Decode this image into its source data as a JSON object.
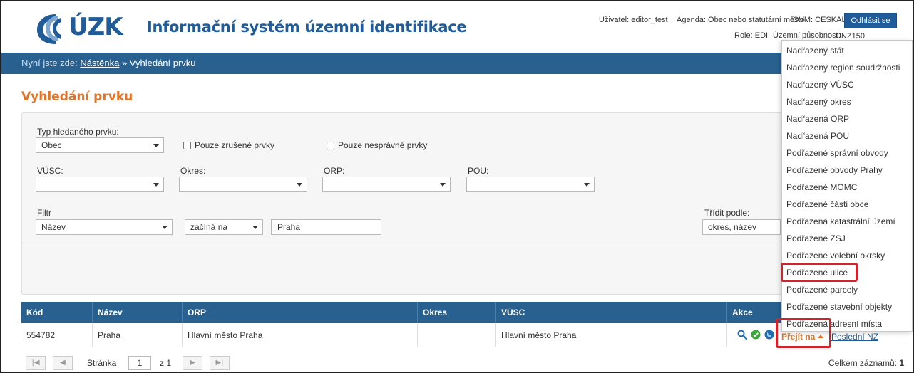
{
  "header": {
    "logo_text": "ÚZK",
    "app_title": "Informační systém územní identifikace",
    "user_label": "Uživatel: editor_test",
    "agenda_label": "Agenda: Obec nebo statutární město",
    "ovm_label": "OVM: CESKALIPA",
    "role_label": "Role: EDI",
    "scope_label": "Územní působnost:",
    "scope_value": "UNZ150",
    "logout_label": "Odhlásit se"
  },
  "breadcrumb": {
    "lead": "Nyní jste zde:",
    "home": "Nástěnka",
    "separator": "»",
    "current": "Vyhledání prvku"
  },
  "page_title": "Vyhledání prvku",
  "filters": {
    "type_label": "Typ hledaného prvku:",
    "type_value": "Obec",
    "only_cancelled_label": "Pouze zrušené prvky",
    "only_incorrect_label": "Pouze nesprávné prvky",
    "vusc_label": "VÚSC:",
    "okres_label": "Okres:",
    "orp_label": "ORP:",
    "pou_label": "POU:",
    "filter_label": "Filtr",
    "filter_field_value": "Název",
    "filter_op_value": "začíná na",
    "filter_text_value": "Praha",
    "sort_label": "Třídit podle:",
    "sort_value": "okres, název"
  },
  "table": {
    "columns": [
      "Kód",
      "Název",
      "ORP",
      "Okres",
      "VÚSC",
      "Akce"
    ],
    "rows": [
      [
        "554782",
        "Praha",
        "Hlavní město Praha",
        "",
        "Hlavní město Praha"
      ]
    ],
    "goto_label": "Přejít na",
    "last_nz_label": "Poslední NZ"
  },
  "pager": {
    "page_label": "Stránka",
    "page_value": "1",
    "of_label": "z 1",
    "total_label": "Celkem záznamů:",
    "total_value": "1"
  },
  "goto_menu": {
    "items": [
      "Nadřazený stát",
      "Nadřazený region soudržnosti",
      "Nadřazený VÚSC",
      "Nadřazený okres",
      "Nadřazená ORP",
      "Nadřazená POU",
      "Podřazené správní obvody",
      "Podřazené obvody Prahy",
      "Podřazené MOMC",
      "Podřazené části obce",
      "Podřazená katastrální území",
      "Podřazené ZSJ",
      "Podřazené volební okrsky",
      "Podřazené ulice",
      "Podřazené parcely",
      "Podřazené stavební objekty",
      "Podřazená adresní místa"
    ],
    "highlighted_item": "Podřazené ulice"
  },
  "colors": {
    "brand_blue": "#1f5c99",
    "bar_blue": "#286090",
    "accent_orange": "#e67324",
    "highlight_red": "#d2232a"
  },
  "icons": [
    "search-icon",
    "ok-check-icon",
    "globe-icon",
    "pager-first-icon",
    "pager-prev-icon",
    "pager-next-icon",
    "pager-last-icon"
  ]
}
